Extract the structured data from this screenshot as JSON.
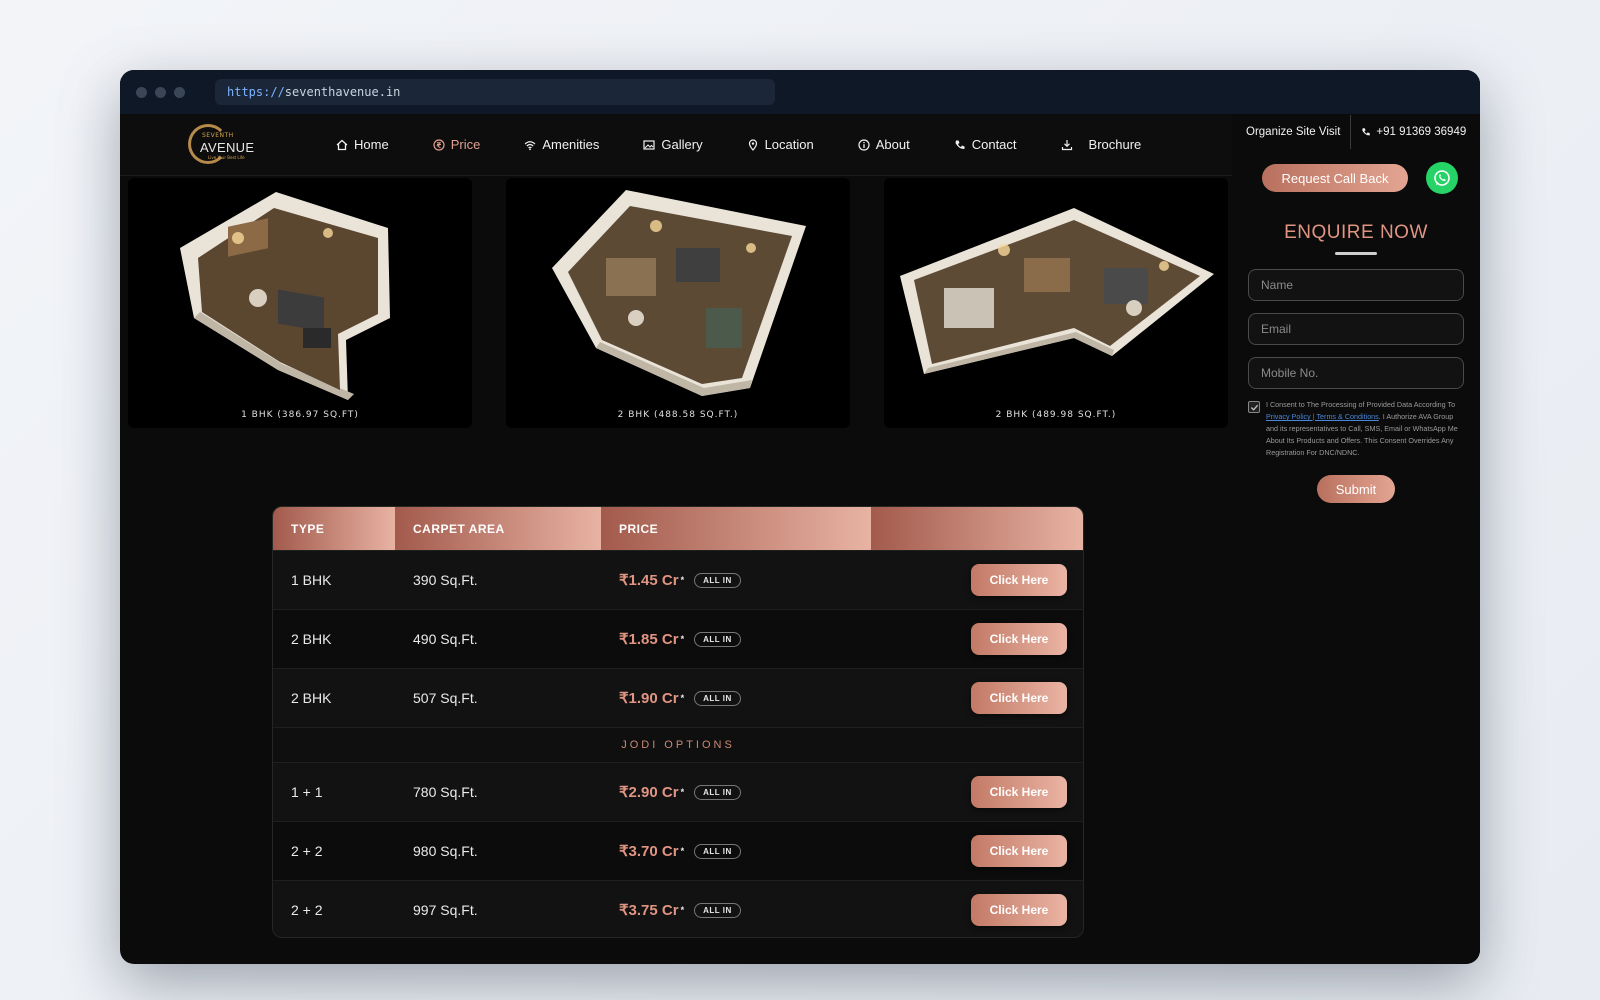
{
  "browser": {
    "url_scheme": "https://",
    "url_host": "seventhavenue.in"
  },
  "logo": {
    "line1": "SEVENTH",
    "line2": "AVENUE",
    "line3": "Live Your Best Life"
  },
  "nav": {
    "items": [
      {
        "label": "Home",
        "icon": "home-icon"
      },
      {
        "label": "Price",
        "icon": "rupee-icon",
        "active": true
      },
      {
        "label": "Amenities",
        "icon": "wifi-icon"
      },
      {
        "label": "Gallery",
        "icon": "image-icon"
      },
      {
        "label": "Location",
        "icon": "location-pin-icon"
      },
      {
        "label": "About",
        "icon": "info-icon"
      },
      {
        "label": "Contact",
        "icon": "phone-icon"
      },
      {
        "label": "Brochure",
        "icon": "download-icon"
      }
    ]
  },
  "sidebar": {
    "site_visit": "Organize Site Visit",
    "phone": "+91 91369 36949",
    "callback_label": "Request Call Back",
    "enquire_title": "ENQUIRE NOW",
    "name_placeholder": "Name",
    "email_placeholder": "Email",
    "mobile_placeholder": "Mobile No.",
    "consent_pre": "I Consent to The Processing of Provided Data According To ",
    "consent_link": "Privacy Policy | Terms & Conditions",
    "consent_post": ". I Authorize AVA Group and its representatives to Call, SMS, Email or WhatsApp Me About Its Products and Offers. This Consent Overrides Any Registration For DNC/NDNC.",
    "submit_label": "Submit"
  },
  "gallery": [
    {
      "caption": "1 BHK (386.97 SQ.FT)"
    },
    {
      "caption": "2 BHK (488.58 SQ.FT.)"
    },
    {
      "caption": "2 BHK (489.98 SQ.FT.)"
    }
  ],
  "price_table": {
    "headers": [
      "TYPE",
      "CARPET AREA",
      "PRICE",
      ""
    ],
    "rows": [
      {
        "type": "1 BHK",
        "area": "390 Sq.Ft.",
        "price": "₹1.45 Cr",
        "mark": "*",
        "badge": "ALL IN",
        "action": "Click Here"
      },
      {
        "type": "2 BHK",
        "area": "490 Sq.Ft.",
        "price": "₹1.85 Cr",
        "mark": "*",
        "badge": "ALL IN",
        "action": "Click Here"
      },
      {
        "type": "2 BHK",
        "area": "507 Sq.Ft.",
        "price": "₹1.90 Cr",
        "mark": "*",
        "badge": "ALL IN",
        "action": "Click Here"
      }
    ],
    "jodi_label": "JODI OPTIONS",
    "jodi_rows": [
      {
        "type": "1 + 1",
        "area": "780 Sq.Ft.",
        "price": "₹2.90 Cr",
        "mark": "*",
        "badge": "ALL IN",
        "action": "Click Here"
      },
      {
        "type": "2 + 2",
        "area": "980 Sq.Ft.",
        "price": "₹3.70 Cr",
        "mark": "*",
        "badge": "ALL IN",
        "action": "Click Here"
      },
      {
        "type": "2 + 2",
        "area": "997 Sq.Ft.",
        "price": "₹3.75 Cr",
        "mark": "*",
        "badge": "ALL IN",
        "action": "Click Here"
      }
    ]
  },
  "colors": {
    "accent": "#e09482",
    "accent_dark": "#a25a4c",
    "whatsapp": "#25d366",
    "background": "#0b0b0b"
  }
}
